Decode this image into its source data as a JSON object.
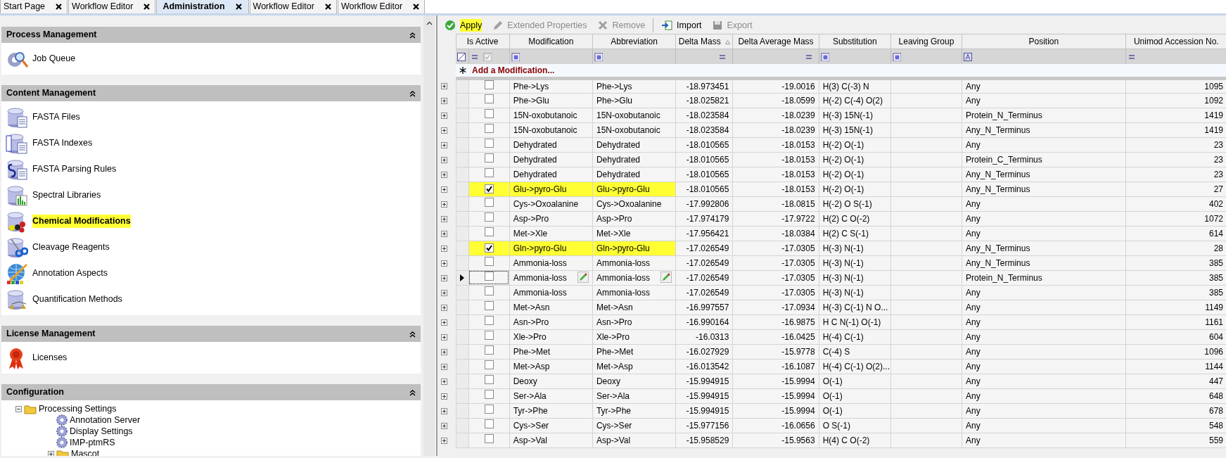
{
  "tabs": [
    {
      "label": "Start Page",
      "selected": false
    },
    {
      "label": "Workflow Editor",
      "selected": false
    },
    {
      "label": "Administration",
      "selected": true
    },
    {
      "label": "Workflow Editor",
      "selected": false
    },
    {
      "label": "Workflow Editor",
      "selected": false
    }
  ],
  "sidebar": {
    "sections": [
      {
        "title": "Process Management",
        "items": [
          {
            "label": "Job Queue",
            "highlighted": false
          }
        ]
      },
      {
        "title": "Content Management",
        "items": [
          {
            "label": "FASTA Files",
            "highlighted": false
          },
          {
            "label": "FASTA Indexes",
            "highlighted": false
          },
          {
            "label": "FASTA Parsing Rules",
            "highlighted": false
          },
          {
            "label": "Spectral Libraries",
            "highlighted": false
          },
          {
            "label": "Chemical Modifications",
            "highlighted": true
          },
          {
            "label": "Cleavage Reagents",
            "highlighted": false
          },
          {
            "label": "Annotation Aspects",
            "highlighted": false
          },
          {
            "label": "Quantification Methods",
            "highlighted": false
          }
        ]
      },
      {
        "title": "License Management",
        "items": [
          {
            "label": "Licenses",
            "highlighted": false
          }
        ]
      },
      {
        "title": "Configuration",
        "tree": [
          {
            "label": "Processing Settings",
            "kind": "folder",
            "expanded": true,
            "children": [
              {
                "label": "Annotation Server",
                "kind": "setting"
              },
              {
                "label": "Display Settings",
                "kind": "setting"
              },
              {
                "label": "IMP-ptmRS",
                "kind": "setting"
              },
              {
                "label": "Mascot",
                "kind": "folder",
                "expanded": false
              }
            ]
          }
        ]
      }
    ]
  },
  "toolbar": [
    {
      "label": "Apply",
      "disabled": false,
      "highlighted": true
    },
    {
      "label": "Extended Properties",
      "disabled": true,
      "highlighted": false
    },
    {
      "label": "Remove",
      "disabled": true,
      "highlighted": false
    },
    {
      "label": "Import",
      "disabled": false,
      "highlighted": false
    },
    {
      "label": "Export",
      "disabled": true,
      "highlighted": false
    }
  ],
  "table": {
    "columns": [
      {
        "label": "Is Active",
        "sorted": false
      },
      {
        "label": "Modification",
        "sorted": false
      },
      {
        "label": "Abbreviation",
        "sorted": false
      },
      {
        "label": "Delta Mass",
        "sorted": true
      },
      {
        "label": "Delta Average Mass",
        "sorted": false
      },
      {
        "label": "Substitution",
        "sorted": false
      },
      {
        "label": "Leaving Group",
        "sorted": false
      },
      {
        "label": "Position",
        "sorted": false
      },
      {
        "label": "Unimod Accession No.",
        "sorted": false
      }
    ],
    "add_row": "Add a Modification...",
    "rows": [
      {
        "active": false,
        "modification": "Phe->Lys",
        "abbreviation": "Phe->Lys",
        "delta_mass": "-18.973451",
        "delta_average_mass": "-19.0016",
        "substitution": "H(3) C(-3) N",
        "position": "Any",
        "unimod": "1095",
        "highlighted": false,
        "current": false
      },
      {
        "active": false,
        "modification": "Phe->Glu",
        "abbreviation": "Phe->Glu",
        "delta_mass": "-18.025821",
        "delta_average_mass": "-18.0599",
        "substitution": "H(-2) C(-4) O(2)",
        "position": "Any",
        "unimod": "1092",
        "highlighted": false,
        "current": false
      },
      {
        "active": false,
        "modification": "15N-oxobutanoic",
        "abbreviation": "15N-oxobutanoic",
        "delta_mass": "-18.023584",
        "delta_average_mass": "-18.0239",
        "substitution": "H(-3) 15N(-1)",
        "position": "Protein_N_Terminus",
        "unimod": "1419",
        "highlighted": false,
        "current": false
      },
      {
        "active": false,
        "modification": "15N-oxobutanoic",
        "abbreviation": "15N-oxobutanoic",
        "delta_mass": "-18.023584",
        "delta_average_mass": "-18.0239",
        "substitution": "H(-3) 15N(-1)",
        "position": "Any_N_Terminus",
        "unimod": "1419",
        "highlighted": false,
        "current": false
      },
      {
        "active": false,
        "modification": "Dehydrated",
        "abbreviation": "Dehydrated",
        "delta_mass": "-18.010565",
        "delta_average_mass": "-18.0153",
        "substitution": "H(-2) O(-1)",
        "position": "Any",
        "unimod": "23",
        "highlighted": false,
        "current": false
      },
      {
        "active": false,
        "modification": "Dehydrated",
        "abbreviation": "Dehydrated",
        "delta_mass": "-18.010565",
        "delta_average_mass": "-18.0153",
        "substitution": "H(-2) O(-1)",
        "position": "Protein_C_Terminus",
        "unimod": "23",
        "highlighted": false,
        "current": false
      },
      {
        "active": false,
        "modification": "Dehydrated",
        "abbreviation": "Dehydrated",
        "delta_mass": "-18.010565",
        "delta_average_mass": "-18.0153",
        "substitution": "H(-2) O(-1)",
        "position": "Any_N_Terminus",
        "unimod": "23",
        "highlighted": false,
        "current": false
      },
      {
        "active": true,
        "modification": "Glu->pyro-Glu",
        "abbreviation": "Glu->pyro-Glu",
        "delta_mass": "-18.010565",
        "delta_average_mass": "-18.0153",
        "substitution": "H(-2) O(-1)",
        "position": "Any_N_Terminus",
        "unimod": "27",
        "highlighted": true,
        "current": false
      },
      {
        "active": false,
        "modification": "Cys->Oxoalanine",
        "abbreviation": "Cys->Oxoalanine",
        "delta_mass": "-17.992806",
        "delta_average_mass": "-18.0815",
        "substitution": "H(-2) O S(-1)",
        "position": "Any",
        "unimod": "402",
        "highlighted": false,
        "current": false
      },
      {
        "active": false,
        "modification": "Asp->Pro",
        "abbreviation": "Asp->Pro",
        "delta_mass": "-17.974179",
        "delta_average_mass": "-17.9722",
        "substitution": "H(2) C O(-2)",
        "position": "Any",
        "unimod": "1072",
        "highlighted": false,
        "current": false
      },
      {
        "active": false,
        "modification": "Met->Xle",
        "abbreviation": "Met->Xle",
        "delta_mass": "-17.956421",
        "delta_average_mass": "-18.0384",
        "substitution": "H(2) C S(-1)",
        "position": "Any",
        "unimod": "614",
        "highlighted": false,
        "current": false
      },
      {
        "active": true,
        "modification": "Gln->pyro-Glu",
        "abbreviation": "Gln->pyro-Glu",
        "delta_mass": "-17.026549",
        "delta_average_mass": "-17.0305",
        "substitution": "H(-3) N(-1)",
        "position": "Any_N_Terminus",
        "unimod": "28",
        "highlighted": true,
        "current": false
      },
      {
        "active": false,
        "modification": "Ammonia-loss",
        "abbreviation": "Ammonia-loss",
        "delta_mass": "-17.026549",
        "delta_average_mass": "-17.0305",
        "substitution": "H(-3) N(-1)",
        "position": "Any_N_Terminus",
        "unimod": "385",
        "highlighted": false,
        "current": false
      },
      {
        "active": false,
        "modification": "Ammonia-loss",
        "abbreviation": "Ammonia-loss",
        "delta_mass": "-17.026549",
        "delta_average_mass": "-17.0305",
        "substitution": "H(-3) N(-1)",
        "position": "Protein_N_Terminus",
        "unimod": "385",
        "highlighted": false,
        "current": true
      },
      {
        "active": false,
        "modification": "Ammonia-loss",
        "abbreviation": "Ammonia-loss",
        "delta_mass": "-17.026549",
        "delta_average_mass": "-17.0305",
        "substitution": "H(-3) N(-1)",
        "position": "Any",
        "unimod": "385",
        "highlighted": false,
        "current": false
      },
      {
        "active": false,
        "modification": "Met->Asn",
        "abbreviation": "Met->Asn",
        "delta_mass": "-16.997557",
        "delta_average_mass": "-17.0934",
        "substitution": "H(-3) C(-1) N O...",
        "position": "Any",
        "unimod": "1149",
        "highlighted": false,
        "current": false
      },
      {
        "active": false,
        "modification": "Asn->Pro",
        "abbreviation": "Asn->Pro",
        "delta_mass": "-16.990164",
        "delta_average_mass": "-16.9875",
        "substitution": "H C N(-1) O(-1)",
        "position": "Any",
        "unimod": "1161",
        "highlighted": false,
        "current": false
      },
      {
        "active": false,
        "modification": "Xle->Pro",
        "abbreviation": "Xle->Pro",
        "delta_mass": "-16.0313",
        "delta_average_mass": "-16.0425",
        "substitution": "H(-4) C(-1)",
        "position": "Any",
        "unimod": "604",
        "highlighted": false,
        "current": false
      },
      {
        "active": false,
        "modification": "Phe->Met",
        "abbreviation": "Phe->Met",
        "delta_mass": "-16.027929",
        "delta_average_mass": "-15.9778",
        "substitution": "C(-4) S",
        "position": "Any",
        "unimod": "1096",
        "highlighted": false,
        "current": false
      },
      {
        "active": false,
        "modification": "Met->Asp",
        "abbreviation": "Met->Asp",
        "delta_mass": "-16.013542",
        "delta_average_mass": "-16.1087",
        "substitution": "H(-4) C(-1) O(2)...",
        "position": "Any",
        "unimod": "1144",
        "highlighted": false,
        "current": false
      },
      {
        "active": false,
        "modification": "Deoxy",
        "abbreviation": "Deoxy",
        "delta_mass": "-15.994915",
        "delta_average_mass": "-15.9994",
        "substitution": "O(-1)",
        "position": "Any",
        "unimod": "447",
        "highlighted": false,
        "current": false
      },
      {
        "active": false,
        "modification": "Ser->Ala",
        "abbreviation": "Ser->Ala",
        "delta_mass": "-15.994915",
        "delta_average_mass": "-15.9994",
        "substitution": "O(-1)",
        "position": "Any",
        "unimod": "648",
        "highlighted": false,
        "current": false
      },
      {
        "active": false,
        "modification": "Tyr->Phe",
        "abbreviation": "Tyr->Phe",
        "delta_mass": "-15.994915",
        "delta_average_mass": "-15.9994",
        "substitution": "O(-1)",
        "position": "Any",
        "unimod": "678",
        "highlighted": false,
        "current": false
      },
      {
        "active": false,
        "modification": "Cys->Ser",
        "abbreviation": "Cys->Ser",
        "delta_mass": "-15.977156",
        "delta_average_mass": "-16.0656",
        "substitution": "O S(-1)",
        "position": "Any",
        "unimod": "548",
        "highlighted": false,
        "current": false
      },
      {
        "active": false,
        "modification": "Asp->Val",
        "abbreviation": "Asp->Val",
        "delta_mass": "-15.958529",
        "delta_average_mass": "-15.9563",
        "substitution": "H(4) C O(-2)",
        "position": "Any",
        "unimod": "559",
        "highlighted": false,
        "current": false
      }
    ]
  }
}
